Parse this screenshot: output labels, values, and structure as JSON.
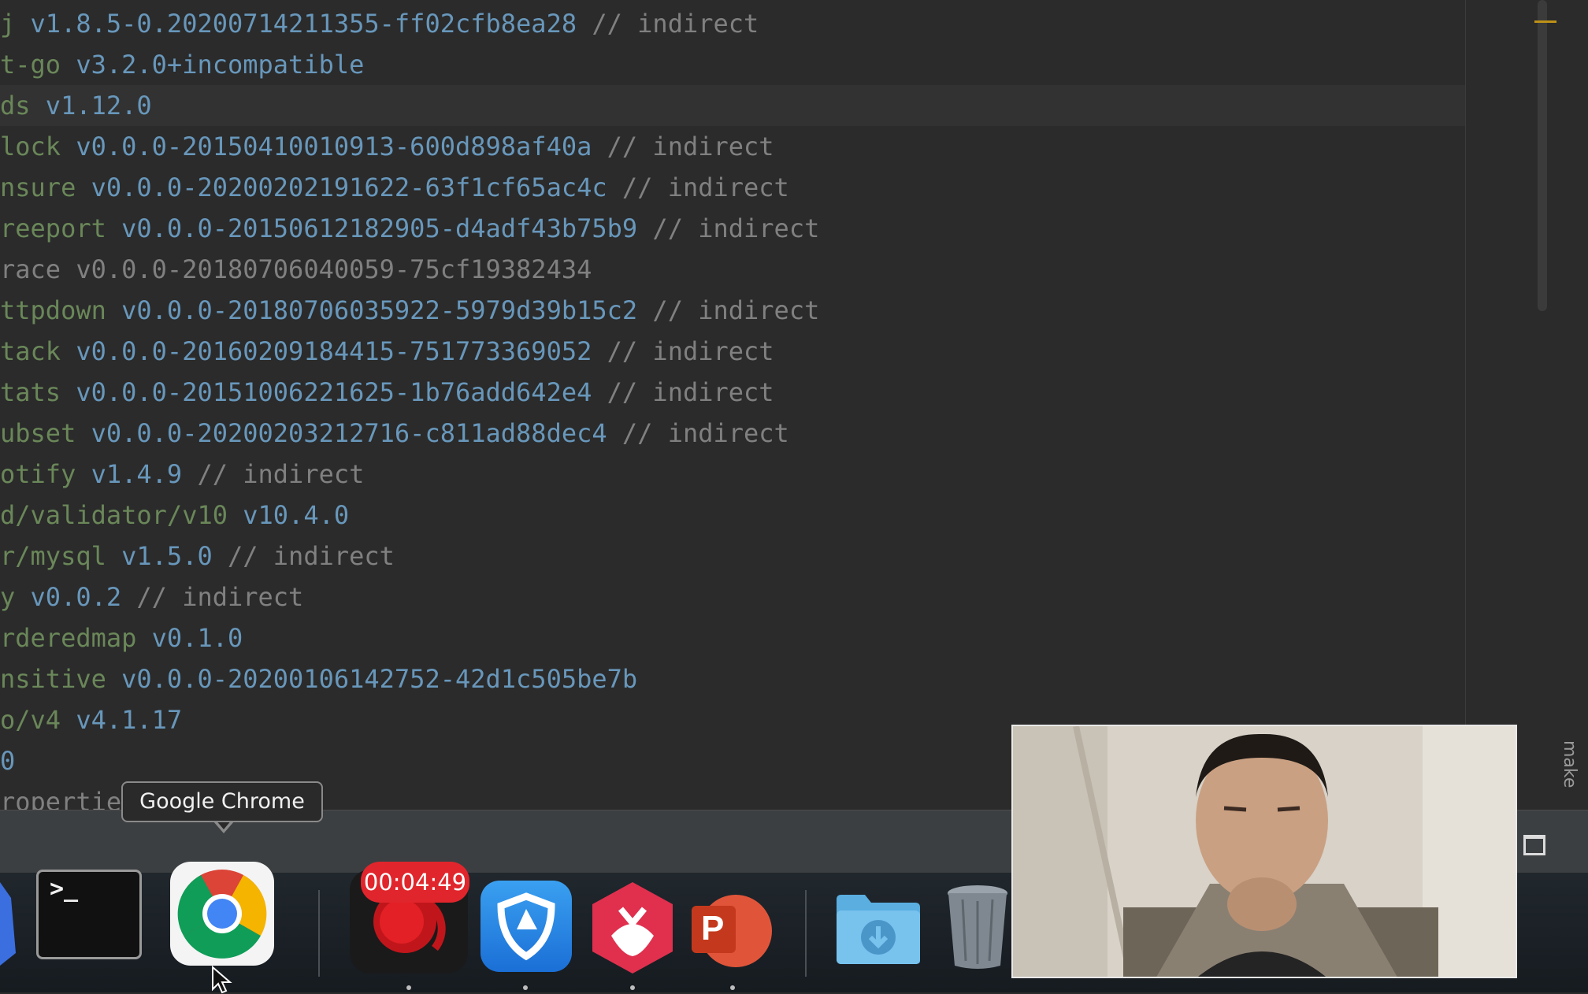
{
  "editor": {
    "lines": [
      {
        "key": "j",
        "version": "v1.8.5-0.20200714211355-ff02cfb8ea28",
        "comment": "// indirect"
      },
      {
        "key": "t-go",
        "version": "v3.2.0+incompatible",
        "comment": ""
      },
      {
        "key": "ds",
        "version": "v1.12.0",
        "comment": ""
      },
      {
        "key": "lock",
        "version": "v0.0.0-20150410010913-600d898af40a",
        "comment": "// indirect"
      },
      {
        "key": "nsure",
        "version": "v0.0.0-20200202191622-63f1cf65ac4c",
        "comment": "// indirect"
      },
      {
        "key": "reeport",
        "version": "v0.0.0-20150612182905-d4adf43b75b9",
        "comment": "// indirect"
      },
      {
        "key": "race",
        "version": "v0.0.0-20180706040059-75cf19382434",
        "comment": ""
      },
      {
        "key": "ttpdown",
        "version": "v0.0.0-20180706035922-5979d39b15c2",
        "comment": "// indirect"
      },
      {
        "key": "tack",
        "version": "v0.0.0-20160209184415-751773369052",
        "comment": "// indirect"
      },
      {
        "key": "tats",
        "version": "v0.0.0-20151006221625-1b76add642e4",
        "comment": "// indirect"
      },
      {
        "key": "ubset",
        "version": "v0.0.0-20200203212716-c811ad88dec4",
        "comment": "// indirect"
      },
      {
        "key": "otify",
        "version": "v1.4.9",
        "comment": "// indirect"
      },
      {
        "key": "d/validator/v10",
        "version": "v10.4.0",
        "comment": ""
      },
      {
        "key": "r/mysql",
        "version": "v1.5.0",
        "comment": "// indirect"
      },
      {
        "key": "y",
        "version": "v0.0.2",
        "comment": "// indirect"
      },
      {
        "key": "rderedmap",
        "version": "v0.1.0",
        "comment": ""
      },
      {
        "key": "nsitive",
        "version": "v0.0.0-20200106142752-42d1c505be7b",
        "comment": ""
      },
      {
        "key": "o/v4",
        "version": "v4.1.17",
        "comment": ""
      },
      {
        "key": "0",
        "version": "",
        "comment": ""
      },
      {
        "key": "ropertie",
        "version": "",
        "comment": ""
      }
    ]
  },
  "side_tab": {
    "label": "make"
  },
  "tooltip": {
    "text": "Google Chrome"
  },
  "dock": {
    "recorder_timer": "00:04:49",
    "terminal_prompt": ">_",
    "powerpoint_letter": "P"
  },
  "colors": {
    "background": "#2b2b2b",
    "key": "#6a8759",
    "version": "#6897bb",
    "comment": "#808080",
    "timer_badge": "#e0262c"
  }
}
